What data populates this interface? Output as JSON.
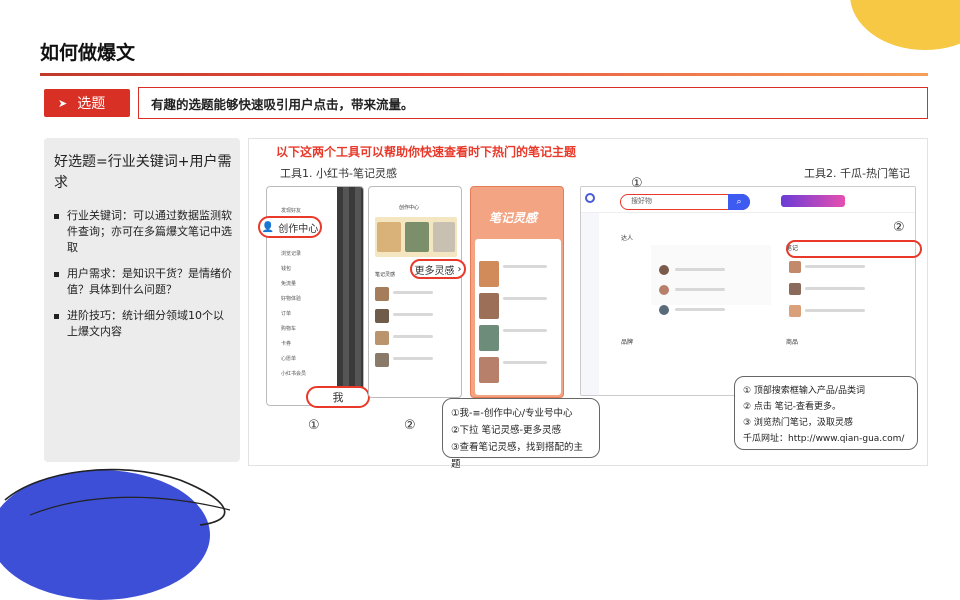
{
  "page": {
    "title": "如何做爆文",
    "section_tag": "选题",
    "tagline": "有趣的选题能够快速吸引用户点击，带来流量。"
  },
  "left": {
    "heading": "好选题=行业关键词+用户需求",
    "bullets": [
      "行业关键词：可以通过数据监测软件查询；亦可在多篇爆文笔记中选取",
      "用户需求：是知识干货？是情绪价值？具体到什么问题？",
      "进阶技巧：统计细分领域10个以上爆文内容"
    ]
  },
  "right": {
    "headline": "以下这两个工具可以帮助你快速查看时下热门的笔记主题",
    "tool1_label": "工具1. 小红书-笔记灵感",
    "tool2_label": "工具2. 千瓜-热门笔记",
    "phone1": {
      "menu_highlight": "创作中心",
      "bottom_highlight": "我",
      "menu_top": "发现好友",
      "items": [
        "浏览记录",
        "钱包",
        "免流量",
        "好物体验",
        "订单",
        "购物车",
        "卡券",
        "心愿单",
        "小红书会员"
      ]
    },
    "phone2": {
      "title": "创作中心",
      "oval": "更多灵感",
      "section": "笔记灵感"
    },
    "phone3": {
      "banner": "笔记灵感"
    },
    "markers": {
      "m1": "①",
      "m2": "②"
    },
    "callout1": [
      "①我-≡-创作中心/专业号中心",
      "②下拉 笔记灵感-更多灵感",
      "③查看笔记灵感，找到搭配的主题"
    ],
    "callout2": [
      "① 顶部搜索框输入产品/品类词",
      "② 点击 笔记-查看更多。",
      "③ 浏览热门笔记，汲取灵感",
      "千瓜网址：http://www.qian-gua.com/"
    ],
    "qiangua": {
      "search_placeholder": "搜好物",
      "section_kol": "达人",
      "section_notes": "笔记",
      "section_brand": "品牌",
      "section_goods": "商品"
    }
  }
}
